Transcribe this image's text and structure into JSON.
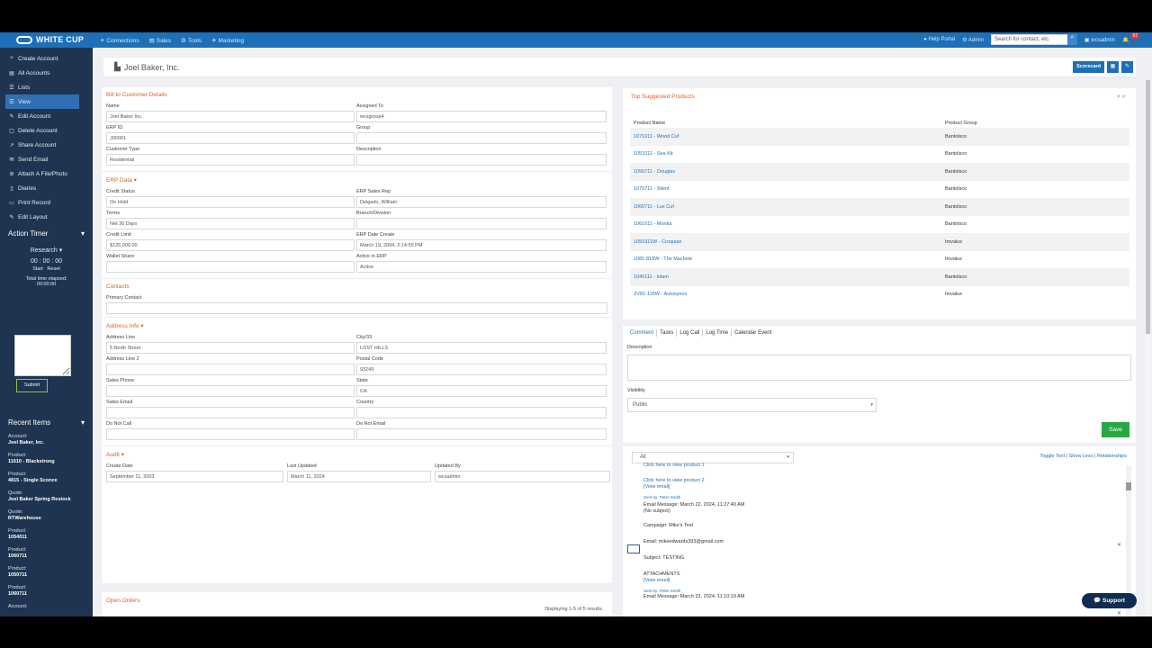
{
  "topbar": {
    "brand": "WHITE CUP",
    "nav": [
      {
        "icon": "connections-icon",
        "label": "Connections"
      },
      {
        "icon": "sales-icon",
        "label": "Sales"
      },
      {
        "icon": "tools-icon",
        "label": "Tools"
      },
      {
        "icon": "marketing-icon",
        "label": "Marketing"
      }
    ],
    "help": "Help Portal",
    "admin": "Admin",
    "search_placeholder": "Search for contact, etc.",
    "user": "wcsadmin",
    "notification_count": "57"
  },
  "sidebar": {
    "items": [
      {
        "icon": "+",
        "label": "Create Account"
      },
      {
        "icon": "▤",
        "label": "All Accounts"
      },
      {
        "icon": "☰",
        "label": "Lists"
      },
      {
        "icon": "☰",
        "label": "View"
      },
      {
        "icon": "✎",
        "label": "Edit Account"
      },
      {
        "icon": "▢",
        "label": "Delete Account"
      },
      {
        "icon": "↗",
        "label": "Share Account"
      },
      {
        "icon": "✉",
        "label": "Send Email"
      },
      {
        "icon": "⊘",
        "label": "Attach A File/Photo"
      },
      {
        "icon": "▯",
        "label": "Diaries"
      },
      {
        "icon": "▭",
        "label": "Print Record"
      },
      {
        "icon": "✎",
        "label": "Edit Layout"
      }
    ],
    "action_timer": {
      "title": "Action Timer",
      "selected": "Research",
      "clock": "00 : 00 : 00",
      "start": "Start",
      "reset": "Reset",
      "total_label": "Total time elapsed:",
      "total_value": "00:00:00",
      "submit": "Submit"
    },
    "recent_title": "Recent Items",
    "recent": [
      {
        "type": "Account:",
        "value": "Joel Baker, Inc."
      },
      {
        "type": "Product:",
        "value": "11610 - Blackstrong"
      },
      {
        "type": "Product:",
        "value": "4815 - Single Sconce"
      },
      {
        "type": "Quote:",
        "value": "Joel Baker Spring Restock"
      },
      {
        "type": "Quote:",
        "value": "RTWarehouse"
      },
      {
        "type": "Product:",
        "value": "1054011"
      },
      {
        "type": "Product:",
        "value": "1060711"
      },
      {
        "type": "Product:",
        "value": "1050711"
      },
      {
        "type": "Product:",
        "value": "1060711"
      },
      {
        "type": "Account:",
        "value": ""
      }
    ]
  },
  "header": {
    "title": "Joel Baker, Inc.",
    "scorecard": "Scorecard"
  },
  "details": {
    "title": "Bill to Customer Details",
    "fields": [
      {
        "label": "Name",
        "value": "Joel Baker Inc."
      },
      {
        "label": "Assigned To",
        "value": "wcsgroup4"
      },
      {
        "label": "ERP ID",
        "value": "J00001"
      },
      {
        "label": "Group",
        "value": ""
      },
      {
        "label": "Customer Type",
        "value": "Residential"
      },
      {
        "label": "Description",
        "value": ""
      }
    ]
  },
  "erp": {
    "title": "ERP Data ▾",
    "fields": [
      {
        "label": "Credit Status",
        "value": "On Hold"
      },
      {
        "label": "ERP Sales Rep",
        "value": "Delgado, William"
      },
      {
        "label": "Terms",
        "value": "Net 30 Days"
      },
      {
        "label": "Branch/Division",
        "value": ""
      },
      {
        "label": "Credit Limit",
        "value": "$125,000.00"
      },
      {
        "label": "ERP Date Create",
        "value": "March 19, 2004, 2:14:55 PM"
      },
      {
        "label": "Wallet Share",
        "value": ""
      },
      {
        "label": "Active in ERP",
        "value": "Active"
      }
    ]
  },
  "contacts": {
    "title": "Contacts",
    "primary_label": "Primary Contact",
    "primary_value": ""
  },
  "address": {
    "title": "Address Info ▾",
    "fields": [
      {
        "label": "Address Line",
        "value": "5 North Street"
      },
      {
        "label": "City/33",
        "value": "LOST HILLS"
      },
      {
        "label": "Address Line 2",
        "value": ""
      },
      {
        "label": "Postal Code",
        "value": "93249"
      },
      {
        "label": "Sales Phone",
        "value": ""
      },
      {
        "label": "State",
        "value": "CA"
      },
      {
        "label": "Sales Email",
        "value": ""
      },
      {
        "label": "Country",
        "value": ""
      },
      {
        "label": "Do Not Call",
        "value": ""
      },
      {
        "label": "Do Not Email",
        "value": ""
      }
    ]
  },
  "audit": {
    "title": "Audit ▾",
    "fields": [
      {
        "label": "Create Date",
        "value": "September 11, 2003"
      },
      {
        "label": "Last Updated",
        "value": "March 11, 2024"
      },
      {
        "label": "Updated By",
        "value": "wcsadmin"
      }
    ]
  },
  "orders": {
    "title": "Open Orders",
    "summary": "Displaying 1-5 of 5 results."
  },
  "products": {
    "title": "Top Suggested Products",
    "col1": "Product Name",
    "col2": "Product Group",
    "rows": [
      {
        "name": "1071011 - Wood Cuf",
        "group": "Bantolsco"
      },
      {
        "name": "1051011 - Sea Kit",
        "group": "Bantolsco"
      },
      {
        "name": "1050711 - Douglas",
        "group": "Bantolsco"
      },
      {
        "name": "1070711 - Silent",
        "group": "Bantolsco"
      },
      {
        "name": "1060711 - Lux Cuf",
        "group": "Bantolsco"
      },
      {
        "name": "1061011 - Montia",
        "group": "Bantolsco"
      },
      {
        "name": "1050311W - Croquian",
        "group": "Imvalus"
      },
      {
        "name": "1081-818W - The Machete",
        "group": "Imvalus"
      },
      {
        "name": "1040111 - Inlam",
        "group": "Bantolsco"
      },
      {
        "name": "ZV81-115W - Autosynos",
        "group": "Imvalus"
      }
    ]
  },
  "activity": {
    "tabs": [
      "Comment",
      "Tasks",
      "Log Call",
      "Log Time",
      "Calendar Event"
    ],
    "description_label": "Description",
    "visibility_label": "Visibility",
    "visibility_value": "Public",
    "save": "Save"
  },
  "feed": {
    "filter": "All",
    "links": "Toggle Text | Show Less | Relationships",
    "line0": "Click here to view product 1",
    "line1": "Click here to view product 2",
    "line2": "[View email]",
    "line3": "Sent by: Peter Smith",
    "email1": "Email Message: March 22, 2024, 11:27:40 AM",
    "email1_sub": "(No subject)",
    "campaign": "Campaign: Mike's Test",
    "email_addr": "Email: mikeedwards393@gmail.com",
    "subject": "Subject: TESTING",
    "attachments": "ATTACHMENTS",
    "view_email2": "[View email]",
    "sent2": "Sent by: Peter Smith",
    "email2": "Email Message: March 22, 2024, 11:10:19 AM"
  },
  "support": "Support"
}
